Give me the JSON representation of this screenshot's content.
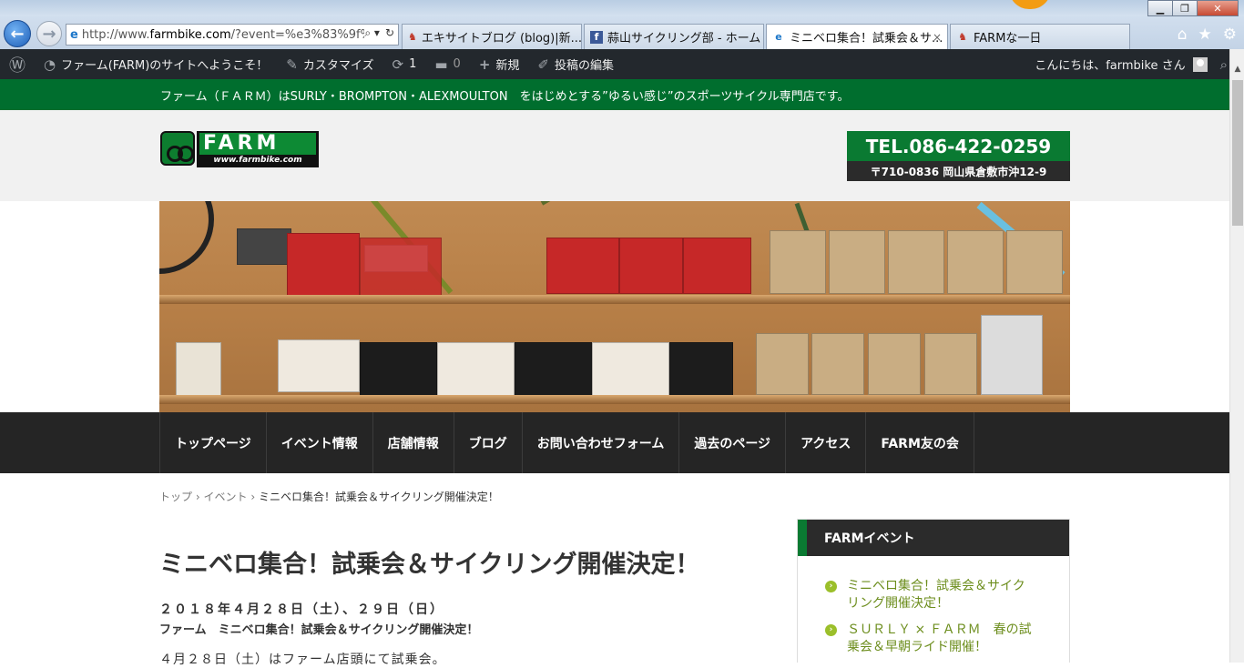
{
  "browser": {
    "address": {
      "prefix": "http://www.",
      "domain": "farmbike.com",
      "rest": "/?event=%e3%83%9f%",
      "search_glyph": "⌕ ▾",
      "refresh_glyph": "↻"
    },
    "tabs": [
      {
        "icon": "excite-icon",
        "label": "エキサイトブログ (blog)|新..."
      },
      {
        "icon": "facebook-icon",
        "glyph": "f",
        "label": "蒜山サイクリング部 - ホーム"
      },
      {
        "icon": "ie-icon",
        "label": "ミニベロ集合！試乗会＆サ..."
      },
      {
        "icon": "excite-icon",
        "label": "FARMな一日"
      }
    ],
    "tab_close": "×",
    "window_buttons": {
      "minimize": "▁",
      "maximize": "❐",
      "close": "✕"
    },
    "toolbar_icons": {
      "home": "⌂",
      "favorites": "★",
      "settings": "⚙"
    }
  },
  "adminbar": {
    "wp_logo": "Ⓦ",
    "site_name": "ファーム(FARM)のサイトへようこそ！",
    "customize": "カスタマイズ",
    "updates_count": "1",
    "comments_count": "0",
    "new": "新規",
    "edit_post": "投稿の編集",
    "greeting": "こんにちは、farmbike さん"
  },
  "site": {
    "tagline": "ファーム（ＦＡＲＭ）はSURLY・BROMPTON・ALEXMOULTON　をはじめとする”ゆるい感じ”のスポーツサイクル専門店です。",
    "logo_word": "FARM",
    "logo_url": "www.farmbike.com",
    "tel": "TEL.086-422-0259",
    "address": "〒710-0836 岡山県倉敷市沖12-9"
  },
  "nav": {
    "items": [
      {
        "label": "トップページ"
      },
      {
        "label": "イベント情報"
      },
      {
        "label": "店舗情報"
      },
      {
        "label": "ブログ"
      },
      {
        "label": "お問い合わせフォーム"
      },
      {
        "label": "過去のページ"
      },
      {
        "label": "アクセス"
      },
      {
        "label": "FARM友の会"
      }
    ]
  },
  "breadcrumb": {
    "top": "トップ",
    "event": "イベント",
    "current": "ミニベロ集合！試乗会＆サイクリング開催決定！",
    "sep": "›"
  },
  "post": {
    "title": "ミニベロ集合！試乗会＆サイクリング開催決定！",
    "date": "２０１８年４月２８日（土）、２９日（日）",
    "subtitle": "ファーム　ミニベロ集合！試乗会＆サイクリング開催決定！",
    "body_first_line": "４月２８日（土）はファーム店頭にて試乗会。"
  },
  "sidebar": {
    "widget_title": "FARMイベント",
    "items": [
      {
        "label": "ミニベロ集合！試乗会＆サイクリング開催決定！"
      },
      {
        "label": "ＳＵＲＬＹ × ＦＡＲＭ　春の試乗会＆早朝ライド開催！"
      }
    ]
  },
  "colors": {
    "brand_green": "#006e2e",
    "admin_bar": "#23282d",
    "nav_dark": "#252525",
    "link_green": "#6d8e1e"
  }
}
